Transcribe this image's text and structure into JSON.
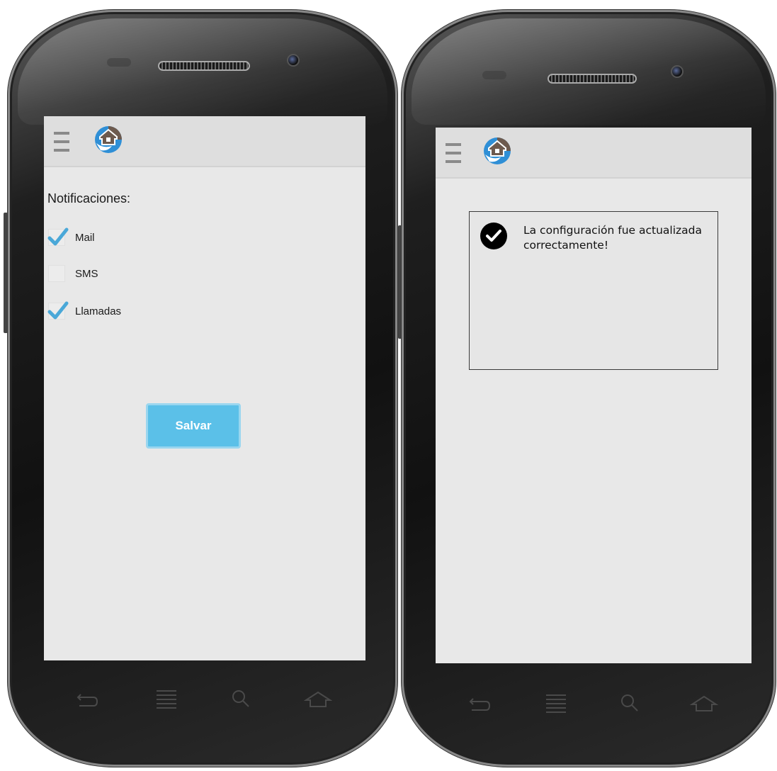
{
  "settings_screen": {
    "section_title": "Notificaciones:",
    "options": [
      {
        "label": "Mail",
        "checked": true
      },
      {
        "label": "SMS",
        "checked": false
      },
      {
        "label": "Llamadas",
        "checked": true
      }
    ],
    "save_label": "Salvar"
  },
  "confirmation_screen": {
    "message": "La configuración fue actualizada correctamente!"
  },
  "nav_icons": [
    "back-icon",
    "menu-icon",
    "search-icon",
    "home-icon"
  ],
  "colors": {
    "accent": "#5bc0e8",
    "checkmark": "#4aa8d8",
    "screen_bg": "#e8e8e8",
    "appbar_bg": "#dedede",
    "logo_brown": "#6d5a4e",
    "logo_blue": "#2f8fd6"
  }
}
